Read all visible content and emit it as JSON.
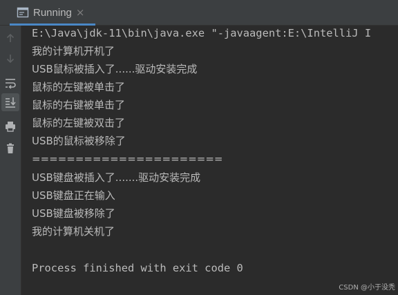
{
  "tab": {
    "label": "Running",
    "close_glyph": "×",
    "icon": "console-window-icon"
  },
  "sidebar": {
    "buttons": [
      {
        "name": "rerun-up-icon",
        "tooltip": ""
      },
      {
        "name": "down-arrow-icon",
        "tooltip": ""
      },
      {
        "name": "soft-wrap-icon",
        "tooltip": ""
      },
      {
        "name": "scroll-to-end-icon",
        "tooltip": ""
      },
      {
        "name": "print-icon",
        "tooltip": ""
      },
      {
        "name": "trash-icon",
        "tooltip": ""
      }
    ]
  },
  "console": {
    "lines": [
      "E:\\Java\\jdk-11\\bin\\java.exe \"-javaagent:E:\\IntelliJ I",
      "我的计算机开机了",
      "USB鼠标被插入了......驱动安装完成",
      "鼠标的左键被单击了",
      "鼠标的右键被单击了",
      "鼠标的左键被双击了",
      "USB的鼠标被移除了",
      "======================",
      "USB键盘被插入了.......驱动安装完成",
      "USB键盘正在输入",
      "USB键盘被移除了",
      "我的计算机关机了",
      "",
      "Process finished with exit code 0"
    ]
  },
  "watermark": "CSDN @小于没秃",
  "colors": {
    "background": "#2b2b2b",
    "text": "#bbbbbb",
    "accent": "#4a88c7",
    "panel": "#3c3f41"
  }
}
